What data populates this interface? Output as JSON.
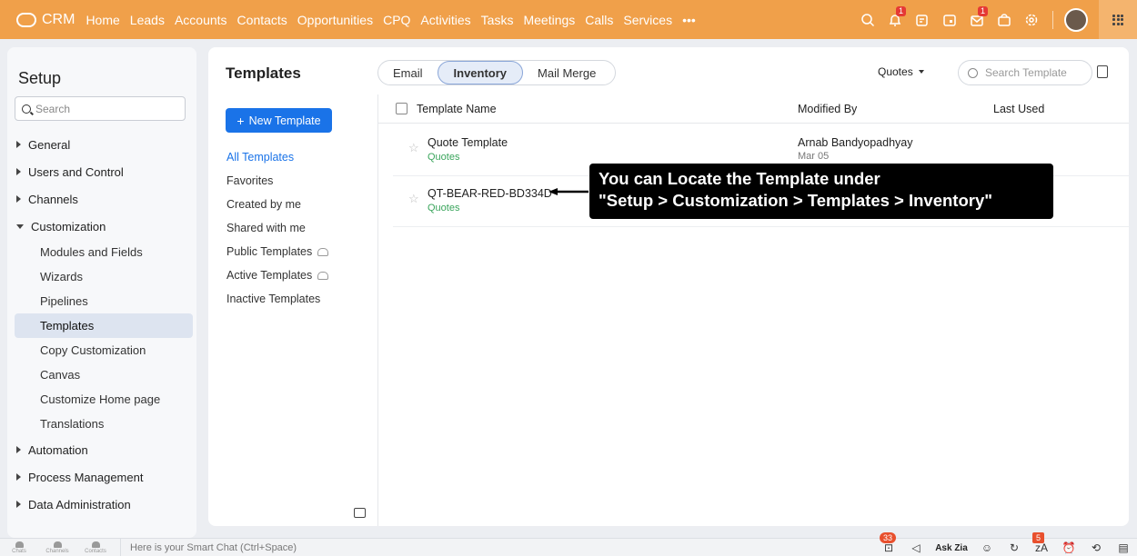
{
  "nav": {
    "brand": "CRM",
    "items": [
      "Home",
      "Leads",
      "Accounts",
      "Contacts",
      "Opportunities",
      "CPQ",
      "Activities",
      "Tasks",
      "Meetings",
      "Calls",
      "Services",
      "•••"
    ],
    "notification_badges": [
      "1",
      "1"
    ]
  },
  "setup": {
    "title": "Setup",
    "search_placeholder": "Search",
    "menu": {
      "general": "General",
      "users": "Users and Control",
      "channels": "Channels",
      "customization": "Customization",
      "sub": [
        "Modules and Fields",
        "Wizards",
        "Pipelines",
        "Templates",
        "Copy Customization",
        "Canvas",
        "Customize Home page",
        "Translations"
      ],
      "automation": "Automation",
      "process": "Process Management",
      "data_admin": "Data Administration"
    }
  },
  "templates": {
    "title": "Templates",
    "tabs": [
      "Email",
      "Inventory",
      "Mail Merge"
    ],
    "module": "Quotes",
    "search_placeholder": "Search Template",
    "new_button": "New Template",
    "filters": [
      "All Templates",
      "Favorites",
      "Created by me",
      "Shared with me",
      "Public Templates",
      "Active Templates",
      "Inactive Templates"
    ],
    "columns": [
      "Template Name",
      "Modified By",
      "Last Used"
    ],
    "rows": [
      {
        "name": "Quote Template",
        "module": "Quotes",
        "modified_by": "Arnab Bandyopadhyay",
        "date": "Mar 05"
      },
      {
        "name": "QT-BEAR-RED-BD334D",
        "module": "Quotes"
      }
    ]
  },
  "callout": {
    "line1": "You can Locate the Template under",
    "line2": "\"Setup > Customization > Templates > Inventory\""
  },
  "bottombar": {
    "icons": [
      "Chats",
      "Channels",
      "Contacts"
    ],
    "smart_chat_placeholder": "Here is your Smart Chat (Ctrl+Space)",
    "chat_count": "33",
    "ask_zia": "Ask Zia",
    "zia_count": "5"
  },
  "colors": {
    "topbar": "#f0a04a",
    "primary": "#1a73e8",
    "module_tag": "#3aa55c"
  }
}
